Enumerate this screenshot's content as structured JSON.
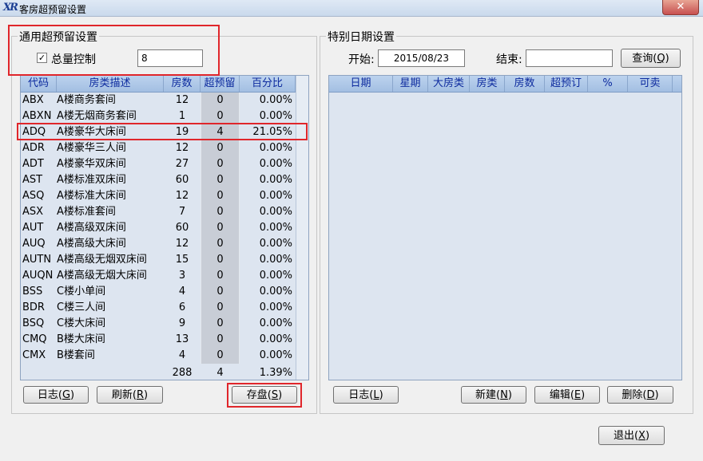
{
  "window": {
    "title": "客房超预留设置",
    "close": "✕",
    "app_icon": "XR"
  },
  "general": {
    "title": "通用超预留设置",
    "total_control_label": "总量控制",
    "total_control_checked": true,
    "check_mark": "✓",
    "total_value": "8",
    "columns": [
      "代码",
      "房类描述",
      "房数",
      "超预留",
      "百分比"
    ],
    "rows": [
      {
        "code": "ABX",
        "desc": "A楼商务套间",
        "rooms": "12",
        "over": "0",
        "pct": "0.00%"
      },
      {
        "code": "ABXN",
        "desc": "A楼无烟商务套间",
        "rooms": "1",
        "over": "0",
        "pct": "0.00%"
      },
      {
        "code": "ADQ",
        "desc": "A楼豪华大床间",
        "rooms": "19",
        "over": "4",
        "pct": "21.05%"
      },
      {
        "code": "ADR",
        "desc": "A楼豪华三人间",
        "rooms": "12",
        "over": "0",
        "pct": "0.00%"
      },
      {
        "code": "ADT",
        "desc": "A楼豪华双床间",
        "rooms": "27",
        "over": "0",
        "pct": "0.00%"
      },
      {
        "code": "AST",
        "desc": "A楼标准双床间",
        "rooms": "60",
        "over": "0",
        "pct": "0.00%"
      },
      {
        "code": "ASQ",
        "desc": "A楼标准大床间",
        "rooms": "12",
        "over": "0",
        "pct": "0.00%"
      },
      {
        "code": "ASX",
        "desc": "A楼标准套间",
        "rooms": "7",
        "over": "0",
        "pct": "0.00%"
      },
      {
        "code": "AUT",
        "desc": "A楼高级双床间",
        "rooms": "60",
        "over": "0",
        "pct": "0.00%"
      },
      {
        "code": "AUQ",
        "desc": "A楼高级大床间",
        "rooms": "12",
        "over": "0",
        "pct": "0.00%"
      },
      {
        "code": "AUTN",
        "desc": "A楼高级无烟双床间",
        "rooms": "15",
        "over": "0",
        "pct": "0.00%"
      },
      {
        "code": "AUQN",
        "desc": "A楼高级无烟大床间",
        "rooms": "3",
        "over": "0",
        "pct": "0.00%"
      },
      {
        "code": "BSS",
        "desc": "C楼小单间",
        "rooms": "4",
        "over": "0",
        "pct": "0.00%"
      },
      {
        "code": "BDR",
        "desc": "C楼三人间",
        "rooms": "6",
        "over": "0",
        "pct": "0.00%"
      },
      {
        "code": "BSQ",
        "desc": "C楼大床间",
        "rooms": "9",
        "over": "0",
        "pct": "0.00%"
      },
      {
        "code": "CMQ",
        "desc": "B楼大床间",
        "rooms": "13",
        "over": "0",
        "pct": "0.00%"
      },
      {
        "code": "CMX",
        "desc": "B楼套间",
        "rooms": "4",
        "over": "0",
        "pct": "0.00%"
      }
    ],
    "totals": {
      "rooms": "288",
      "over": "4",
      "pct": "1.39%"
    },
    "buttons": {
      "log": {
        "label": "日志(",
        "key": "G",
        "end": ")"
      },
      "refresh": {
        "label": "刷新(",
        "key": "R",
        "end": ")"
      },
      "save": {
        "label": "存盘(",
        "key": "S",
        "end": ")"
      }
    }
  },
  "special": {
    "title": "特别日期设置",
    "start_label": "开始:",
    "start_value": "2015/08/23",
    "end_label": "结束:",
    "end_value": "",
    "query": {
      "label": "查询(",
      "key": "Q",
      "end": ")"
    },
    "columns": [
      "日期",
      "星期",
      "大房类",
      "房类",
      "房数",
      "超预订",
      "%",
      "可卖"
    ],
    "buttons": {
      "log": {
        "label": "日志(",
        "key": "L",
        "end": ")"
      },
      "new": {
        "label": "新建(",
        "key": "N",
        "end": ")"
      },
      "edit": {
        "label": "编辑(",
        "key": "E",
        "end": ")"
      },
      "delete": {
        "label": "删除(",
        "key": "D",
        "end": ")"
      }
    }
  },
  "exit": {
    "label": "退出(",
    "key": "X",
    "end": ")"
  }
}
